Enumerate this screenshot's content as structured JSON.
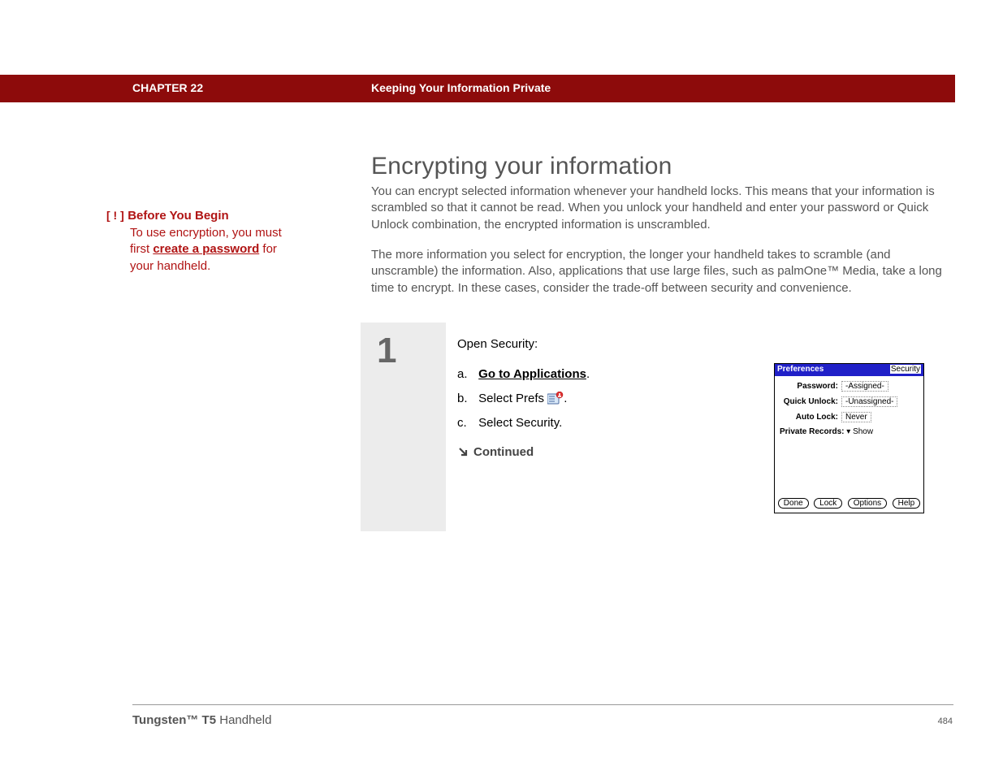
{
  "header": {
    "chapter": "CHAPTER 22",
    "title": "Keeping Your Information Private"
  },
  "heading": "Encrypting your information",
  "paragraph1": "You can encrypt selected information whenever your handheld locks. This means that your information is scrambled so that it cannot be read. When you unlock your handheld and enter your password or Quick Unlock combination, the encrypted information is unscrambled.",
  "paragraph2": "The more information you select for encryption, the longer your handheld takes to scramble (and unscramble) the information. Also, applications that use large files, such as palmOne™ Media, take a long time to encrypt. In these cases, consider the trade-off between security and convenience.",
  "sidebar": {
    "marker": "[ ! ]",
    "heading": "Before You Begin",
    "body_pre": "To use encryption, you must first ",
    "link": "create a password",
    "body_post": " for your handheld."
  },
  "step": {
    "number": "1",
    "title": "Open Security:",
    "a_label": "a.",
    "a_link": "Go to Applications",
    "a_suffix": ".",
    "b_label": "b.",
    "b_text_pre": "Select Prefs ",
    "b_text_post": ".",
    "c_label": "c.",
    "c_text": "Select Security.",
    "continued": "Continued"
  },
  "palm": {
    "titlebar_left": "Preferences",
    "titlebar_right": "Security",
    "rows": {
      "password_label": "Password:",
      "password_value": "-Assigned-",
      "quickunlock_label": "Quick Unlock:",
      "quickunlock_value": "-Unassigned-",
      "autolock_label": "Auto Lock:",
      "autolock_value": "Never"
    },
    "private_label": "Private Records:",
    "private_value": "Show",
    "buttons": {
      "done": "Done",
      "lock": "Lock",
      "options": "Options",
      "help": "Help"
    }
  },
  "footer": {
    "product_bold": "Tungsten™ T5",
    "product_rest": " Handheld",
    "page": "484"
  }
}
